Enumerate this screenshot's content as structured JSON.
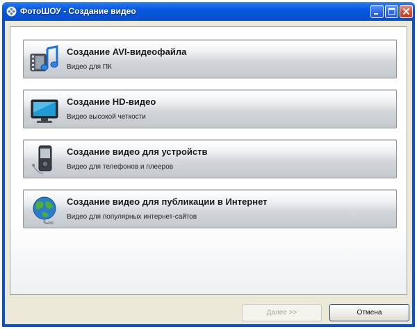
{
  "window": {
    "title": "ФотоШОУ - Создание видео"
  },
  "options": [
    {
      "title": "Создание AVI-видеофайла",
      "subtitle": "Видео для ПК",
      "icon": "film-music-icon"
    },
    {
      "title": "Создание HD-видео",
      "subtitle": "Видео высокой четкости",
      "icon": "monitor-icon"
    },
    {
      "title": "Создание видео для устройств",
      "subtitle": "Видео для телефонов и плееров",
      "icon": "mobile-player-icon"
    },
    {
      "title": "Создание видео для публикации в Интернет",
      "subtitle": "Видео для популярных интернет-сайтов",
      "icon": "globe-icon"
    }
  ],
  "buttons": {
    "next": "Далее >>",
    "cancel": "Отмена"
  },
  "colors": {
    "titlebar": "#0a59dc",
    "window_bg": "#ece9d8",
    "close_button": "#d6482a"
  }
}
